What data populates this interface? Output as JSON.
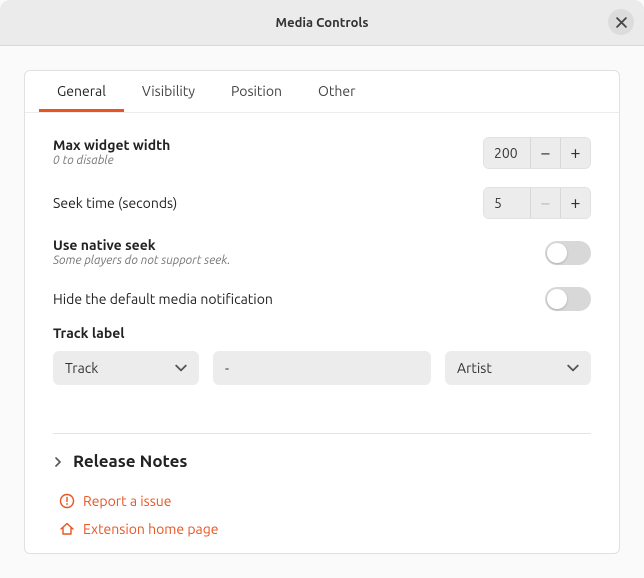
{
  "window": {
    "title": "Media Controls"
  },
  "tabs": [
    "General",
    "Visibility",
    "Position",
    "Other"
  ],
  "general": {
    "maxWidth": {
      "title": "Max widget width",
      "sub": "0 to disable",
      "value": "200"
    },
    "seekTime": {
      "title": "Seek time (seconds)",
      "value": "5"
    },
    "nativeSeek": {
      "title": "Use native seek",
      "sub": "Some players do not support seek."
    },
    "hideNotif": {
      "title": "Hide the default media notification"
    },
    "trackLabel": {
      "title": "Track label",
      "left": "Track",
      "sep": "-",
      "right": "Artist"
    }
  },
  "footer": {
    "release": "Release Notes",
    "report": "Report a issue",
    "home": "Extension home page"
  }
}
